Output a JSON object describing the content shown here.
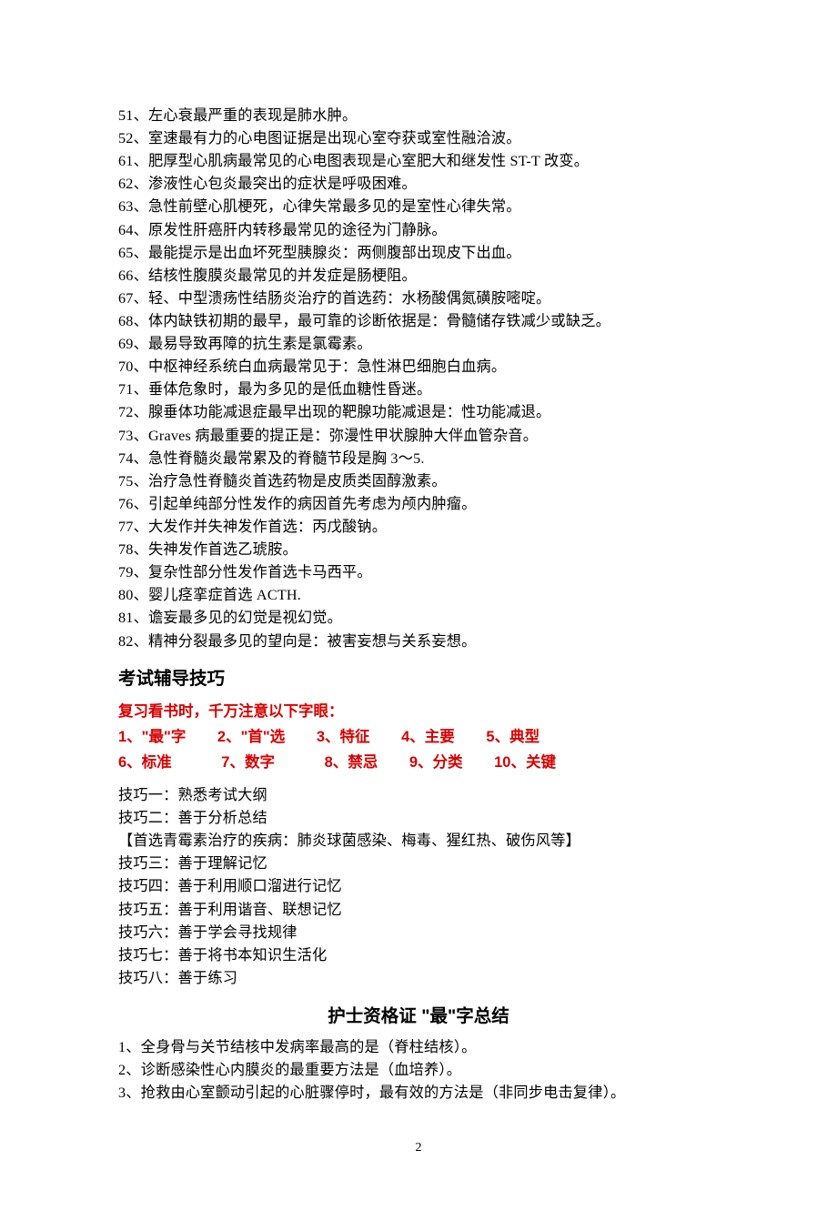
{
  "list1": [
    "51、左心衰最严重的表现是肺水肿。",
    "52、室速最有力的心电图证据是出现心室夺获或室性融洽波。",
    "61、肥厚型心肌病最常见的心电图表现是心室肥大和继发性 ST-T 改变。",
    "62、渗液性心包炎最突出的症状是呼吸困难。",
    "63、急性前壁心肌梗死，心律失常最多见的是室性心律失常。",
    "64、原发性肝癌肝内转移最常见的途径为门静脉。",
    "65、最能提示是出血坏死型胰腺炎：两侧腹部出现皮下出血。",
    "66、结核性腹膜炎最常见的并发症是肠梗阻。",
    "67、轻、中型溃疡性结肠炎治疗的首选药：水杨酸偶氮磺胺嘧啶。",
    "68、体内缺铁初期的最早，最可靠的诊断依据是：骨髓储存铁减少或缺乏。",
    "69、最易导致再障的抗生素是氯霉素。",
    "70、中枢神经系统白血病最常见于：急性淋巴细胞白血病。",
    "71、垂体危象时，最为多见的是低血糖性昏迷。",
    "72、腺垂体功能减退症最早出现的靶腺功能减退是：性功能减退。",
    "73、Graves 病最重要的提正是：弥漫性甲状腺肿大伴血管杂音。",
    "74、急性脊髓炎最常累及的脊髓节段是胸 3～5.",
    "75、治疗急性脊髓炎首选药物是皮质类固醇激素。",
    "76、引起单纯部分性发作的病因首先考虑为颅内肿瘤。",
    "77、大发作并失神发作首选：丙戊酸钠。",
    "78、失神发作首选乙琥胺。",
    "79、复杂性部分性发作首选卡马西平。",
    "80、婴儿痉挛症首选 ACTH.",
    "81、谵妄最多见的幻觉是视幻觉。",
    "82、精神分裂最多见的望向是：被害妄想与关系妄想。"
  ],
  "heading1": "考试辅导技巧",
  "redIntro": "复习看书时，千万注意以下字眼：",
  "redRow1": {
    "c1": "1、\"最\"字",
    "c2": "2、\"首\"选",
    "c3": "3、特征",
    "c4": "4、主要",
    "c5": "5、典型"
  },
  "redRow2": {
    "c1": "6、标准",
    "c2": "7、数字",
    "c3": "8、禁忌",
    "c4": "9、分类",
    "c5": "10、关键"
  },
  "tips": [
    "技巧一：熟悉考试大纲",
    "技巧二：善于分析总结",
    "【首选青霉素治疗的疾病：肺炎球菌感染、梅毒、猩红热、破伤风等】",
    "技巧三：善于理解记忆",
    "技巧四：善于利用顺口溜进行记忆",
    "技巧五：善于利用谐音、联想记忆",
    "技巧六：善于学会寻找规律",
    "技巧七：善于将书本知识生活化",
    "技巧八：善于练习"
  ],
  "heading2_prefix": "护士资格证 ",
  "heading2_quote": "\"最\"",
  "heading2_suffix": "字总结",
  "list2": [
    "1、全身骨与关节结核中发病率最高的是（脊柱结核）。",
    "2、诊断感染性心内膜炎的最重要方法是（血培养）。",
    "3、抢救由心室颤动引起的心脏骤停时，最有效的方法是（非同步电击复律）。"
  ],
  "pageNumber": "2"
}
